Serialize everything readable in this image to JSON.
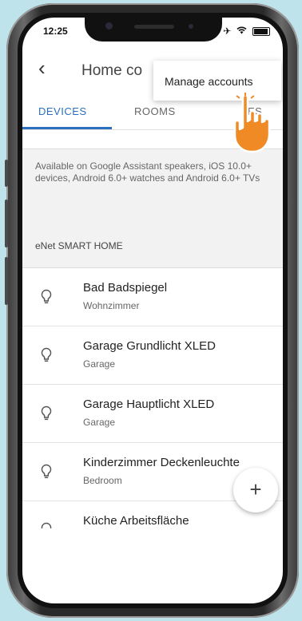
{
  "status_bar": {
    "time": "12:25",
    "icons": [
      "airplane-icon",
      "wifi-icon",
      "battery-icon"
    ]
  },
  "app_bar": {
    "back_icon": "back-arrow-icon",
    "title": "Home co"
  },
  "tabs": [
    {
      "label": "DEVICES",
      "active": true
    },
    {
      "label": "ROOMS",
      "active": false
    },
    {
      "label": "ES",
      "active": false
    }
  ],
  "menu": {
    "item": "Manage accounts"
  },
  "notice": "Available on Google Assistant speakers, iOS 10.0+ devices, Android 6.0+ watches and Android 6.0+ TVs",
  "section": {
    "title": "eNet SMART HOME"
  },
  "devices": [
    {
      "name": "Bad Badspiegel",
      "room": "Wohnzimmer",
      "icon": "lightbulb-icon"
    },
    {
      "name": "Garage Grundlicht XLED",
      "room": "Garage",
      "icon": "lightbulb-icon"
    },
    {
      "name": "Garage Hauptlicht XLED",
      "room": "Garage",
      "icon": "lightbulb-icon"
    },
    {
      "name": "Kinderzimmer Deckenleuchte",
      "room": "Bedroom",
      "icon": "lightbulb-icon"
    },
    {
      "name": "Küche Arbeitsfläche",
      "room": "",
      "icon": "lightbulb-icon"
    }
  ],
  "fab": {
    "label": "+"
  },
  "colors": {
    "accent": "#2b6fbf",
    "background": "#bfe3ea",
    "hand": "#f08a24"
  }
}
